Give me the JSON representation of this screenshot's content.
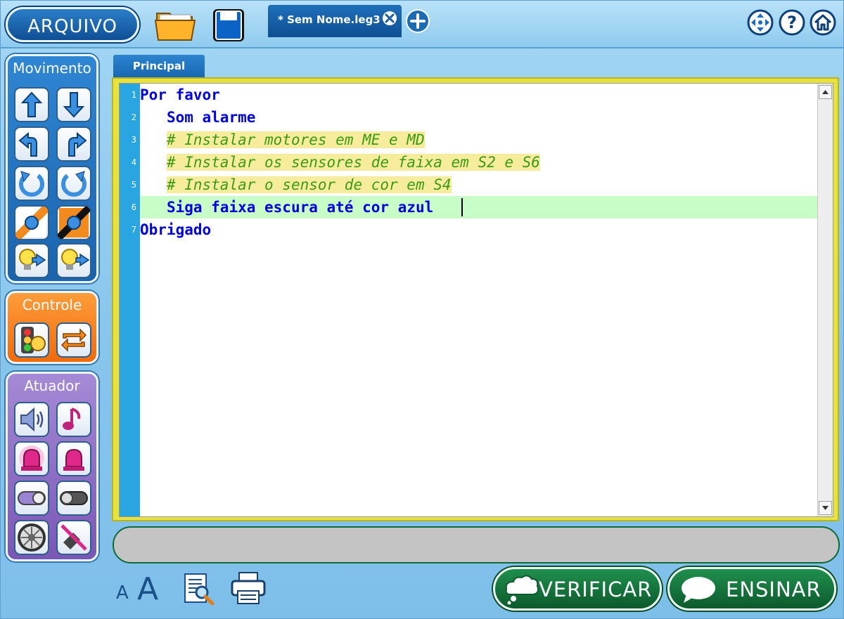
{
  "toolbar": {
    "arquivo_label": "ARQUIVO",
    "open_icon": "folder-open-icon",
    "save_icon": "floppy-disk-icon",
    "file_tab_label": "* Sem Nome.leg3",
    "close_tab_icon": "close-circle-icon",
    "add_tab_icon": "plus-circle-icon",
    "right_icons": [
      "move-arrows-icon",
      "help-icon",
      "home-icon"
    ]
  },
  "sidebar": {
    "movimento": {
      "title": "Movimento",
      "tools": [
        "arrow-up-icon",
        "arrow-down-icon",
        "curve-left-icon",
        "curve-right-icon",
        "rotate-left-icon",
        "rotate-right-icon",
        "follow-line-left-icon",
        "follow-line-right-icon",
        "light-left-icon",
        "light-right-icon"
      ]
    },
    "controle": {
      "title": "Controle",
      "tools": [
        "traffic-light-clock-icon",
        "repeat-loop-icon"
      ]
    },
    "atuador": {
      "title": "Atuador",
      "tools": [
        "speaker-icon",
        "music-note-icon",
        "siren-on-icon",
        "siren-off-icon",
        "switch-on-icon",
        "switch-off-icon",
        "wheel-icon",
        "motor-off-icon"
      ]
    }
  },
  "editor": {
    "tab_label": "Principal",
    "current_line": 6,
    "lines": [
      {
        "n": "1",
        "indent": "",
        "text": "Por favor",
        "type": "kw"
      },
      {
        "n": "2",
        "indent": "   ",
        "text": "Som alarme",
        "type": "kw"
      },
      {
        "n": "3",
        "indent": "   ",
        "text": "# Instalar motores em ME e MD",
        "type": "cm"
      },
      {
        "n": "4",
        "indent": "   ",
        "text": "# Instalar os sensores de faixa em S2 e S6",
        "type": "cm"
      },
      {
        "n": "5",
        "indent": "   ",
        "text": "# Instalar o sensor de cor em S4",
        "type": "cm"
      },
      {
        "n": "6",
        "indent": "   ",
        "text": "Siga faixa escura até cor azul",
        "type": "kw"
      },
      {
        "n": "7",
        "indent": "",
        "text": "Obrigado",
        "type": "kw"
      }
    ]
  },
  "status": {
    "message": ""
  },
  "bottom": {
    "font_small": "A",
    "font_big": "A",
    "preview_icon": "document-search-icon",
    "print_icon": "printer-icon",
    "verificar_label": "VERIFICAR",
    "ensinar_label": "ENSINAR"
  },
  "colors": {
    "keyword": "#0000e0",
    "comment": "#3c9a15",
    "comment_highlight": "#f7ec9c",
    "current_line": "#c8fdc8",
    "gutter": "#29a6e2",
    "editor_border": "#e9e23a",
    "action_green": "#1f8f4d"
  }
}
